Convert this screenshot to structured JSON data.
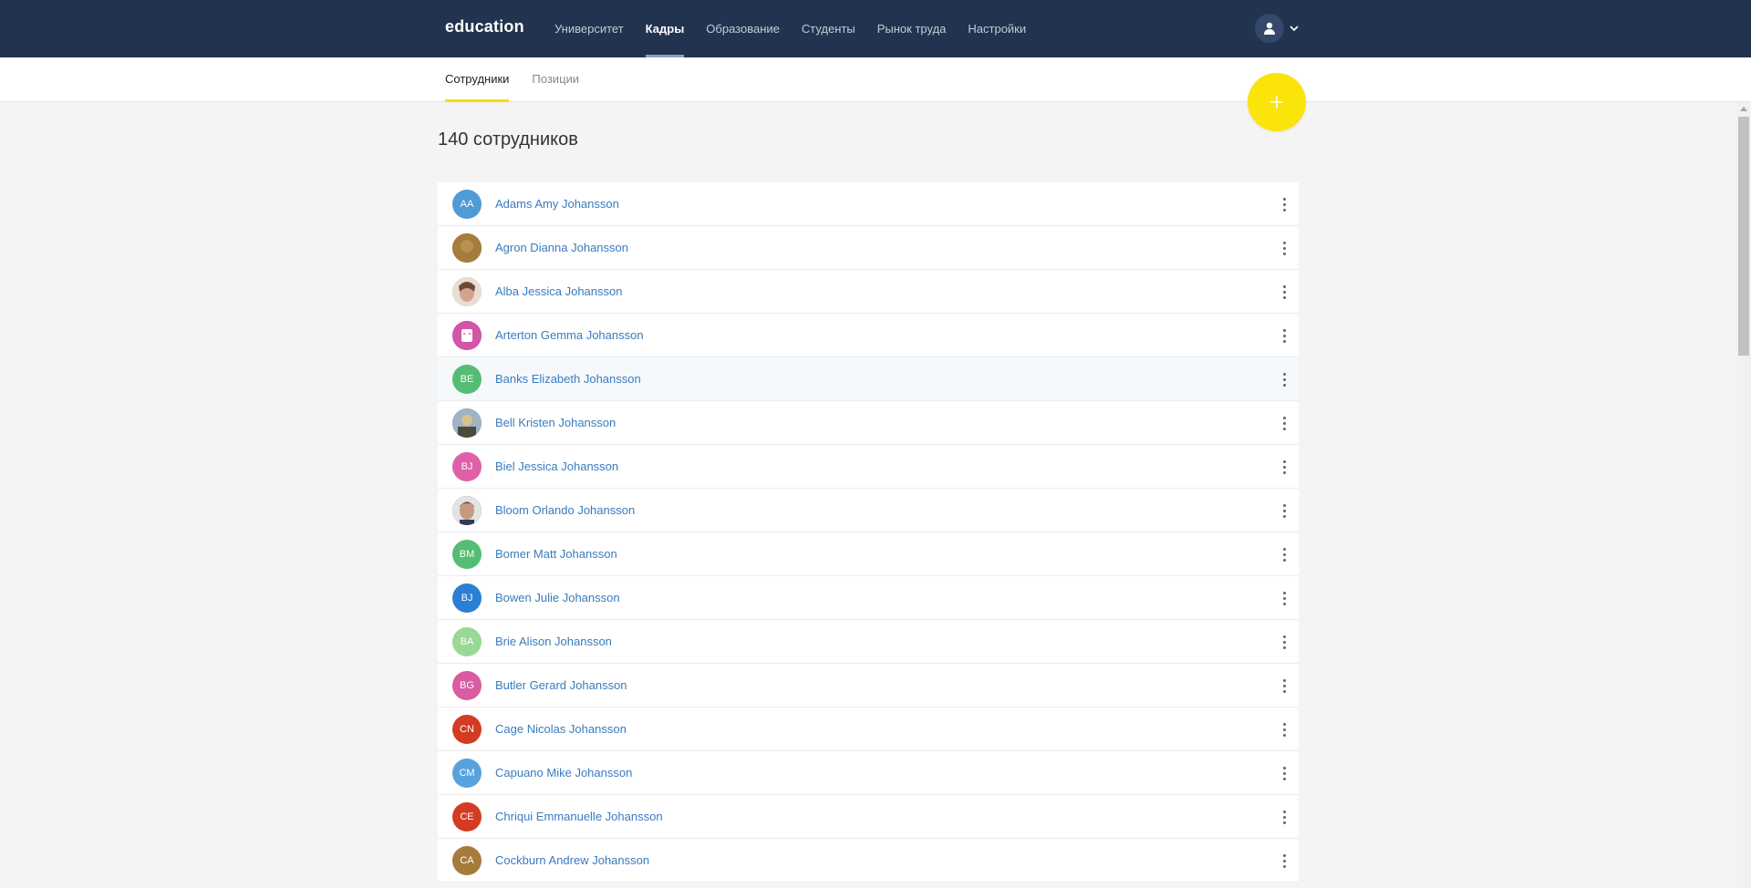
{
  "header": {
    "brand": "education",
    "nav": [
      {
        "label": "Университет",
        "active": false
      },
      {
        "label": "Кадры",
        "active": true
      },
      {
        "label": "Образование",
        "active": false
      },
      {
        "label": "Студенты",
        "active": false
      },
      {
        "label": "Рынок труда",
        "active": false
      },
      {
        "label": "Настройки",
        "active": false
      }
    ],
    "user_icon": "user-icon",
    "menu_icon": "chevron-down-icon"
  },
  "subnav": {
    "tabs": [
      {
        "label": "Сотрудники",
        "active": true
      },
      {
        "label": "Позиции",
        "active": false
      }
    ]
  },
  "fab_icon": "plus-icon",
  "page": {
    "title": "140 сотрудников"
  },
  "employees": [
    {
      "name": "Adams Amy Johansson",
      "initials": "AA",
      "color": "#4e9bd6",
      "photo": false
    },
    {
      "name": "Agron Dianna Johansson",
      "initials": "",
      "color": "#a67c3d",
      "photo": true
    },
    {
      "name": "Alba Jessica Johansson",
      "initials": "",
      "color": "#c99a80",
      "photo": true
    },
    {
      "name": "Arterton Gemma Johansson",
      "initials": "",
      "color": "#d454a8",
      "photo": true
    },
    {
      "name": "Banks Elizabeth Johansson",
      "initials": "BE",
      "color": "#55bd73",
      "photo": false
    },
    {
      "name": "Bell Kristen Johansson",
      "initials": "",
      "color": "#7a7a63",
      "photo": true
    },
    {
      "name": "Biel Jessica Johansson",
      "initials": "BJ",
      "color": "#e060a8",
      "photo": false
    },
    {
      "name": "Bloom Orlando Johansson",
      "initials": "",
      "color": "#5a4a40",
      "photo": true
    },
    {
      "name": "Bomer Matt Johansson",
      "initials": "BM",
      "color": "#55bd73",
      "photo": false
    },
    {
      "name": "Bowen Julie Johansson",
      "initials": "BJ",
      "color": "#2b7fd2",
      "photo": false
    },
    {
      "name": "Brie Alison Johansson",
      "initials": "BA",
      "color": "#99d895",
      "photo": false
    },
    {
      "name": "Butler Gerard Johansson",
      "initials": "BG",
      "color": "#d95ca3",
      "photo": false
    },
    {
      "name": "Cage Nicolas Johansson",
      "initials": "CN",
      "color": "#d33b24",
      "photo": false
    },
    {
      "name": "Capuano Mike Johansson",
      "initials": "CM",
      "color": "#58a3dc",
      "photo": false
    },
    {
      "name": "Chriqui Emmanuelle Johansson",
      "initials": "CE",
      "color": "#d33b24",
      "photo": false
    },
    {
      "name": "Cockburn Andrew Johansson",
      "initials": "CA",
      "color": "#a67c3d",
      "photo": false
    }
  ]
}
